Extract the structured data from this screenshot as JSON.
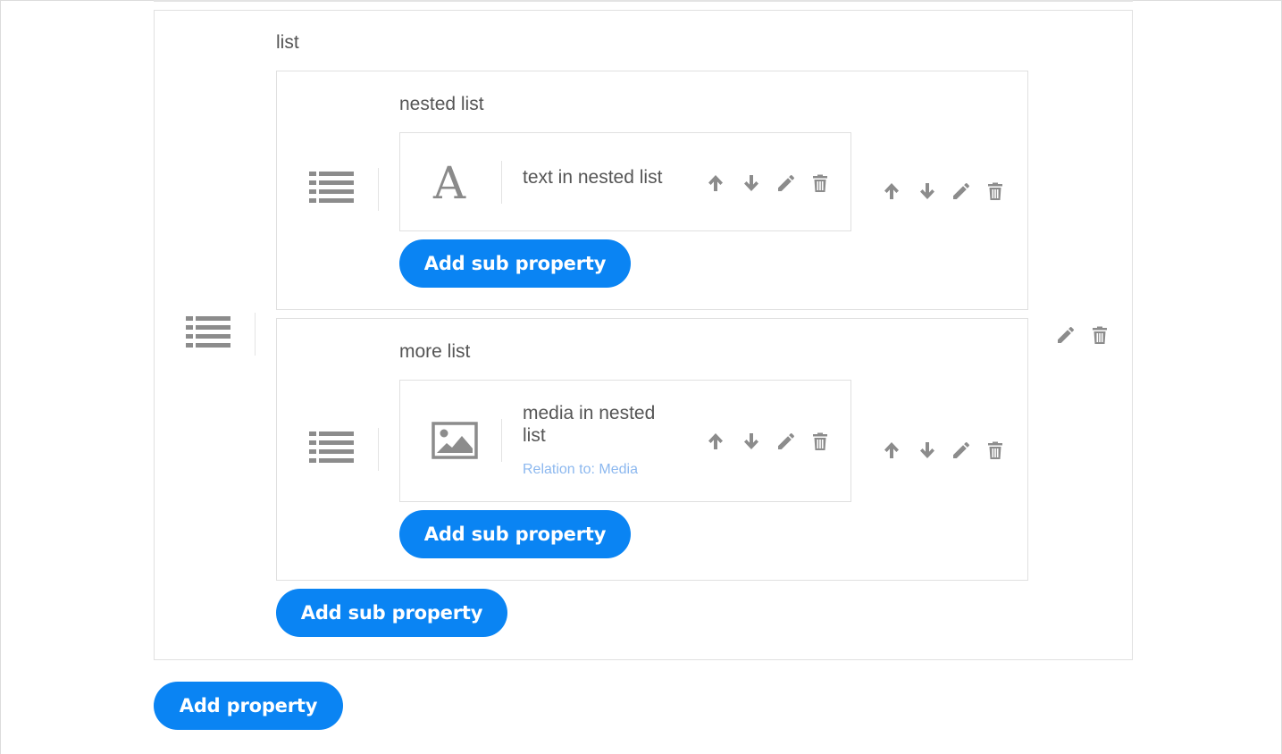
{
  "root_property": {
    "label": "list",
    "type_icon": "list-icon",
    "actions": [
      "edit-icon",
      "trash-icon"
    ],
    "add_sub_property_label": "Add sub property",
    "children": [
      {
        "label": "nested list",
        "type_icon": "list-icon",
        "actions": [
          "arrow-up-icon",
          "arrow-down-icon",
          "edit-icon",
          "trash-icon"
        ],
        "add_sub_property_label": "Add sub property",
        "children": [
          {
            "label": "text in nested list",
            "type_icon": "text-type-icon",
            "type_glyph": "A",
            "actions": [
              "arrow-up-icon",
              "arrow-down-icon",
              "edit-icon",
              "trash-icon"
            ]
          }
        ]
      },
      {
        "label": "more list",
        "type_icon": "list-icon",
        "actions": [
          "arrow-up-icon",
          "arrow-down-icon",
          "edit-icon",
          "trash-icon"
        ],
        "add_sub_property_label": "Add sub property",
        "children": [
          {
            "label_line1": "media in nested",
            "label_line2": "list",
            "relation": "Relation to: Media",
            "type_icon": "image-icon",
            "actions": [
              "arrow-up-icon",
              "arrow-down-icon",
              "edit-icon",
              "trash-icon"
            ]
          }
        ]
      }
    ]
  },
  "add_property_label": "Add property",
  "colors": {
    "primary": "#0a84f3",
    "icon_gray": "#8c8c8c",
    "relation_text": "#8cb8ef",
    "border": "#e0e0e0"
  }
}
